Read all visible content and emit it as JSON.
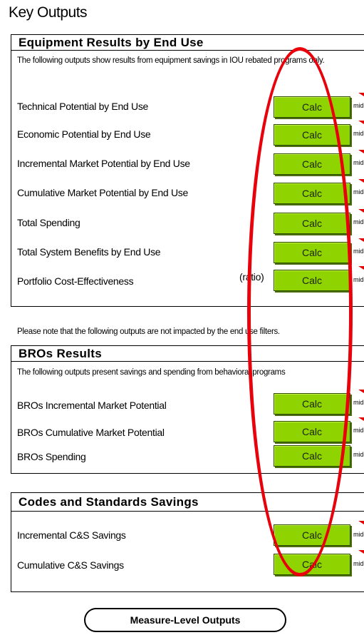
{
  "page_title": "Key Outputs",
  "equipment": {
    "heading": "Equipment Results by End Use",
    "description": "The following outputs show results from equipment savings in IOU rebated programs only.",
    "rows": [
      {
        "label": "Technical Potential by End Use",
        "button": "Calc",
        "mid": "mid",
        "suffix": ""
      },
      {
        "label": "Economic Potential by End Use",
        "button": "Calc",
        "mid": "mid",
        "suffix": ""
      },
      {
        "label": "Incremental Market Potential by End Use",
        "button": "Calc",
        "mid": "mid",
        "suffix": ""
      },
      {
        "label": "Cumulative Market Potential by End Use",
        "button": "Calc",
        "mid": "mid",
        "suffix": ""
      },
      {
        "label": "Total  Spending",
        "button": "Calc",
        "mid": "mid",
        "suffix": ""
      },
      {
        "label": "Total System Benefits by End Use",
        "button": "Calc",
        "mid": "mid",
        "suffix": ""
      },
      {
        "label": "Portfolio Cost-Effectiveness",
        "button": "Calc",
        "mid": "mid",
        "suffix": "(ratio)"
      }
    ]
  },
  "note": "Please note that the following outputs are not impacted by the end use filters.",
  "bros": {
    "heading": "BROs Results",
    "description": "The following outputs present savings and spending from behavioral programs",
    "rows": [
      {
        "label": "BROs Incremental Market Potential",
        "button": "Calc",
        "mid": "mid"
      },
      {
        "label": "BROs Cumulative Market Potential",
        "button": "Calc",
        "mid": "mid"
      },
      {
        "label": "BROs Spending",
        "button": "Calc",
        "mid": "mid"
      }
    ]
  },
  "codes": {
    "heading": "Codes and Standards Savings",
    "rows": [
      {
        "label": "Incremental C&S Savings",
        "button": "Calc",
        "mid": "mid"
      },
      {
        "label": "Cumulative C&S Savings",
        "button": "Calc",
        "mid": "mid"
      }
    ]
  },
  "measure_button": "Measure-Level Outputs",
  "colors": {
    "button_green": "#8fd400",
    "annotation_red": "#e8000b",
    "marker_red": "#e00000"
  }
}
